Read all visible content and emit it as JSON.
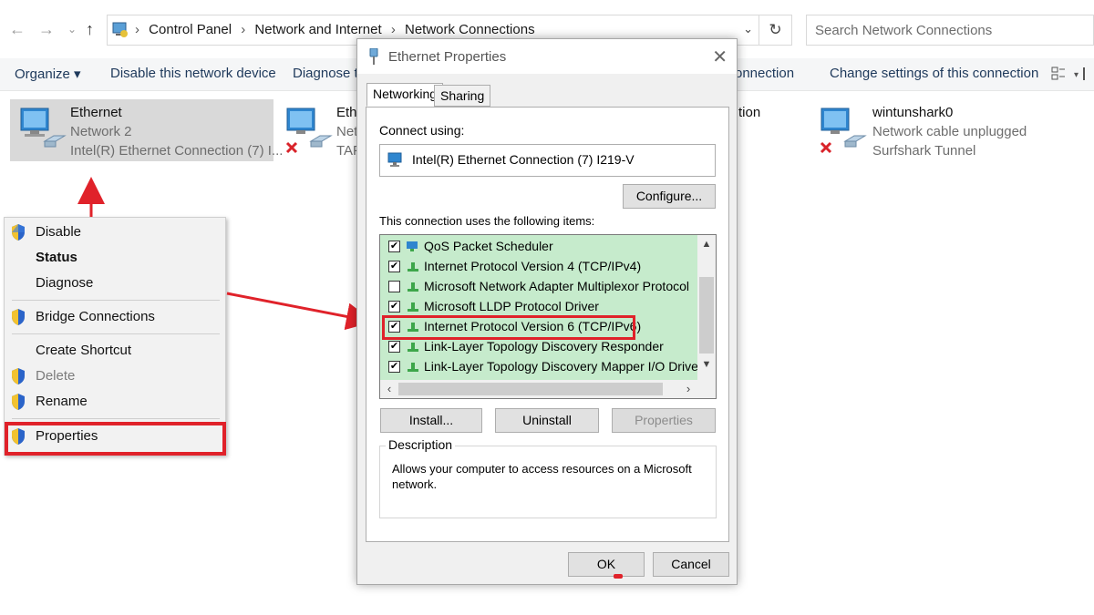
{
  "addressbar": {
    "back": "←",
    "forward": "→",
    "recent": "⌄",
    "up": "↑",
    "breadcrumbs": [
      "Control Panel",
      "Network and Internet",
      "Network Connections"
    ],
    "refresh": "↻",
    "search_placeholder": "Search Network Connections"
  },
  "toolbar": {
    "organize": "Organize ▾",
    "disable": "Disable this network device",
    "diagnose": "Diagnose th",
    "rename": "onnection",
    "change_settings": "Change settings of this connection"
  },
  "connections": [
    {
      "name": "Ethernet",
      "network": "Network 2",
      "adapter": "Intel(R) Ethernet Connection (7) I..."
    },
    {
      "name": "Eth",
      "network": "Net",
      "adapter": "TAP"
    },
    {
      "name": "tion",
      "network": "",
      "adapter": ""
    },
    {
      "name": "wintunshark0",
      "network": "Network cable unplugged",
      "adapter": "Surfshark Tunnel"
    }
  ],
  "context_menu": {
    "items": [
      "Disable",
      "Status",
      "Diagnose",
      "Bridge Connections",
      "Create Shortcut",
      "Delete",
      "Rename",
      "Properties"
    ]
  },
  "dialog": {
    "title": "Ethernet Properties",
    "close": "✕",
    "tabs": [
      "Networking",
      "Sharing"
    ],
    "connect_using_label": "Connect using:",
    "adapter": "Intel(R) Ethernet Connection (7) I219-V",
    "configure_button": "Configure...",
    "items_label": "This connection uses the following items:",
    "items": [
      {
        "label": "QoS Packet Scheduler",
        "checked": true
      },
      {
        "label": "Internet Protocol Version 4 (TCP/IPv4)",
        "checked": true
      },
      {
        "label": "Microsoft Network Adapter Multiplexor Protocol",
        "checked": false
      },
      {
        "label": "Microsoft LLDP Protocol Driver",
        "checked": true
      },
      {
        "label": "Internet Protocol Version 6 (TCP/IPv6)",
        "checked": true
      },
      {
        "label": "Link-Layer Topology Discovery Responder",
        "checked": true
      },
      {
        "label": "Link-Layer Topology Discovery Mapper I/O Driver",
        "checked": true
      }
    ],
    "install_button": "Install...",
    "uninstall_button": "Uninstall",
    "properties_button": "Properties",
    "description_title": "Description",
    "description_text": "Allows your computer to access resources on a Microsoft network.",
    "ok_button": "OK",
    "cancel_button": "Cancel"
  },
  "colors": {
    "annotation_red": "#e0222a",
    "list_highlight_green": "#c6ebcc",
    "selected_item": "#d9d9d9"
  }
}
